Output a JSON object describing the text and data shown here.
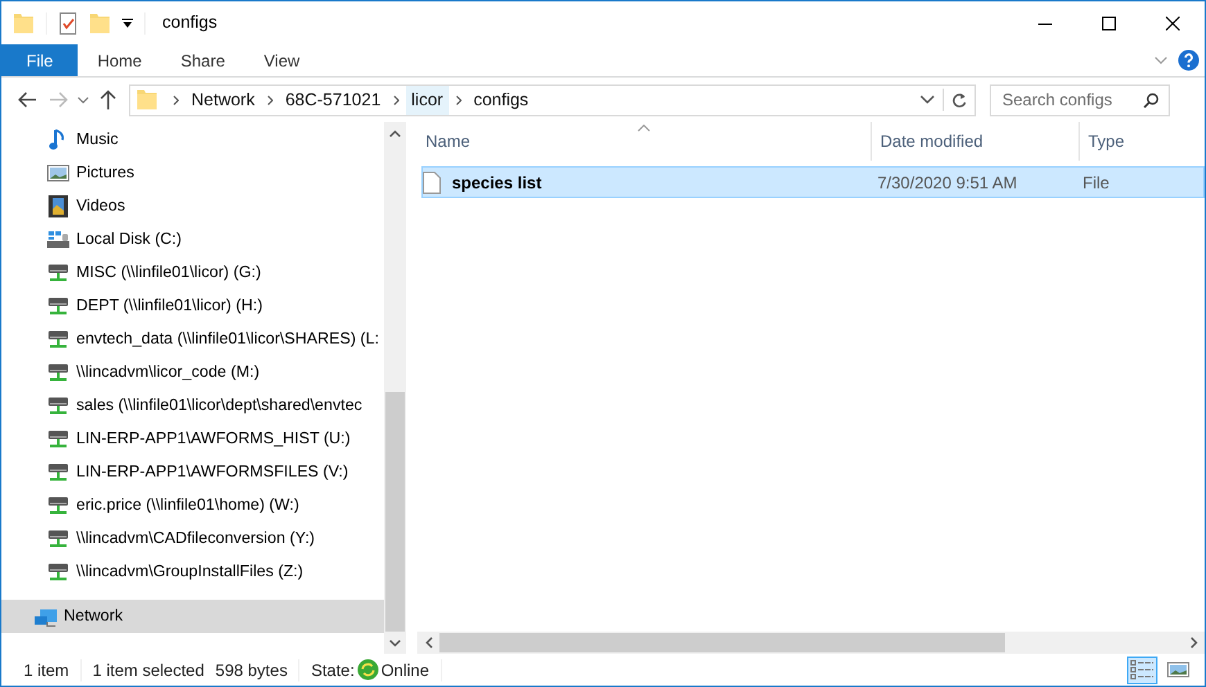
{
  "window": {
    "title": "configs"
  },
  "ribbon": {
    "tabs": [
      {
        "label": "File",
        "kind": "file"
      },
      {
        "label": "Home",
        "kind": "tab"
      },
      {
        "label": "Share",
        "kind": "tab"
      },
      {
        "label": "View",
        "kind": "tab"
      }
    ]
  },
  "address": {
    "crumbs": [
      {
        "label": "Network",
        "highlighted": false
      },
      {
        "label": "68C-571021",
        "highlighted": false
      },
      {
        "label": "licor",
        "highlighted": true
      },
      {
        "label": "configs",
        "highlighted": false
      }
    ],
    "search": {
      "placeholder": "Search configs"
    }
  },
  "sidebar": {
    "items": [
      {
        "label": "Music",
        "kind": "music",
        "selected": false
      },
      {
        "label": "Pictures",
        "kind": "pictures",
        "selected": false
      },
      {
        "label": "Videos",
        "kind": "videos",
        "selected": false
      },
      {
        "label": "Local Disk (C:)",
        "kind": "disk",
        "selected": false
      },
      {
        "label": "MISC (\\\\linfile01\\licor) (G:)",
        "kind": "netdrive",
        "selected": false
      },
      {
        "label": "DEPT (\\\\linfile01\\licor) (H:)",
        "kind": "netdrive",
        "selected": false
      },
      {
        "label": "envtech_data (\\\\linfile01\\licor\\SHARES) (L:",
        "kind": "netdrive",
        "selected": false
      },
      {
        "label": "\\\\lincadvm\\licor_code (M:)",
        "kind": "netdrive",
        "selected": false
      },
      {
        "label": "sales (\\\\linfile01\\licor\\dept\\shared\\envtec",
        "kind": "netdrive",
        "selected": false
      },
      {
        "label": "LIN-ERP-APP1\\AWFORMS_HIST (U:)",
        "kind": "netdrive",
        "selected": false
      },
      {
        "label": "LIN-ERP-APP1\\AWFORMSFILES (V:)",
        "kind": "netdrive",
        "selected": false
      },
      {
        "label": "eric.price (\\\\linfile01\\home) (W:)",
        "kind": "netdrive",
        "selected": false
      },
      {
        "label": "\\\\lincadvm\\CADfileconversion (Y:)",
        "kind": "netdrive",
        "selected": false
      },
      {
        "label": "\\\\lincadvm\\GroupInstallFiles (Z:)",
        "kind": "netdrive",
        "selected": false
      },
      {
        "label": "Network",
        "kind": "network",
        "selected": true
      }
    ]
  },
  "files": {
    "columns": [
      {
        "label": "Name",
        "sorted": true
      },
      {
        "label": "Date modified",
        "sorted": false
      },
      {
        "label": "Type",
        "sorted": false
      }
    ],
    "rows": [
      {
        "name": "species list",
        "date": "7/30/2020 9:51 AM",
        "type": "File",
        "selected": true
      }
    ]
  },
  "status_bar": {
    "count": "1 item",
    "selection": "1 item selected",
    "size": "598 bytes",
    "state_label": "State:",
    "state": "Online",
    "views": [
      {
        "kind": "details",
        "selected": true
      },
      {
        "kind": "large",
        "selected": false
      }
    ]
  }
}
